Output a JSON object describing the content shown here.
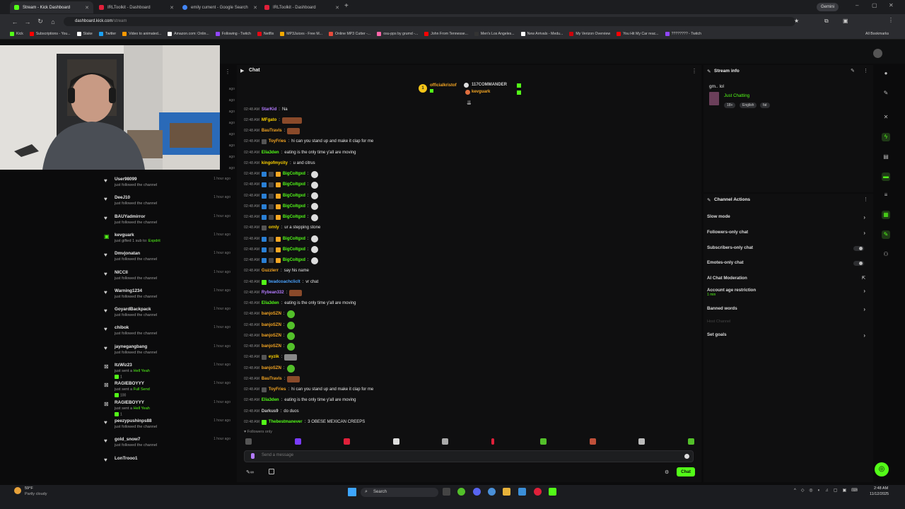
{
  "browser": {
    "tabs": [
      {
        "label": "Stream - Kick Dashboard",
        "color": "#53fc18",
        "active": true
      },
      {
        "label": "IRLToolkit - Dashboard",
        "color": "#e0203a",
        "active": false
      },
      {
        "label": "emily cument - Google Search",
        "color": "#4285f4",
        "active": false
      },
      {
        "label": "IRLToolkit - Dashboard",
        "color": "#e0203a",
        "active": false
      }
    ],
    "gemini_label": "Gemini",
    "url_host": "dashboard.kick.com",
    "url_path": "/stream",
    "bookmarks": [
      {
        "label": "Kick",
        "color": "#53fc18"
      },
      {
        "label": "Subscriptions - You...",
        "color": "#ff0000"
      },
      {
        "label": "Stake",
        "color": "#ffffff"
      },
      {
        "label": "Twitter",
        "color": "#1da1f2"
      },
      {
        "label": "Video to animated...",
        "color": "#ff9900"
      },
      {
        "label": "Amazon.com: Onlin...",
        "color": "#ffffff"
      },
      {
        "label": "Following - Twitch",
        "color": "#9146ff"
      },
      {
        "label": "Netflix",
        "color": "#e50914"
      },
      {
        "label": "MP3Juices - Free M...",
        "color": "#f2a900"
      },
      {
        "label": "Online MP3 Cutter -...",
        "color": "#e74c3c"
      },
      {
        "label": "osu-pps by grumd -...",
        "color": "#ff66aa"
      },
      {
        "label": "John From Tennesse...",
        "color": "#ff0000"
      },
      {
        "label": "Men's Los Angeles...",
        "color": "#333333"
      },
      {
        "label": "New Arrivals - Medu...",
        "color": "#ffffff"
      },
      {
        "label": "My Verizon Overview",
        "color": "#cd040b"
      },
      {
        "label": "You Hit My Car reac...",
        "color": "#ff0000"
      },
      {
        "label": "???????? - Twitch",
        "color": "#9146ff"
      }
    ],
    "all_bookmarks": "All Bookmarks"
  },
  "feed": [
    {
      "name": "User98099",
      "desc": "just followed the channel",
      "time": "1 hour ago",
      "icon": "heart-icon"
    },
    {
      "name": "DeeJ10",
      "desc": "just followed the channel",
      "time": "1 hour ago",
      "icon": "heart-icon"
    },
    {
      "name": "BAUYadmirror",
      "desc": "just followed the channel",
      "time": "1 hour ago",
      "icon": "heart-icon"
    },
    {
      "name": "kevguark",
      "desc": "just gifted 1 sub to: ",
      "highlight": "Expdrit",
      "time": "1 hour ago",
      "icon": "gift-icon"
    },
    {
      "name": "Dmvjonatan",
      "desc": "just followed the channel",
      "time": "1 hour ago",
      "icon": "heart-icon"
    },
    {
      "name": "NICCII",
      "desc": "just followed the channel",
      "time": "1 hour ago",
      "icon": "heart-icon"
    },
    {
      "name": "Warning1234",
      "desc": "just followed the channel",
      "time": "1 hour ago",
      "icon": "heart-icon"
    },
    {
      "name": "GoyardBackpack",
      "desc": "just followed the channel",
      "time": "1 hour ago",
      "icon": "heart-icon"
    },
    {
      "name": "chibok",
      "desc": "just followed the channel",
      "time": "1 hour ago",
      "icon": "heart-icon"
    },
    {
      "name": "jaynegangbang",
      "desc": "just followed the channel",
      "time": "1 hour ago",
      "icon": "heart-icon"
    },
    {
      "name": "ItzWiz23",
      "desc": "just sent a ",
      "highlight": "Hell Yeah",
      "sub": "1",
      "time": "1 hour ago",
      "icon": "kick-icon"
    },
    {
      "name": "RAGIEBOYYY",
      "desc": "just sent a ",
      "highlight": "Full Send",
      "sub": "100",
      "time": "1 hour ago",
      "icon": "kick-icon"
    },
    {
      "name": "RAGIEBOYYY",
      "desc": "just sent a ",
      "highlight": "Hell Yeah",
      "sub": "1",
      "time": "1 hour ago",
      "icon": "kick-icon"
    },
    {
      "name": "peezypushinps88",
      "desc": "just followed the channel",
      "time": "1 hour ago",
      "icon": "heart-icon"
    },
    {
      "name": "gold_snow7",
      "desc": "just followed the channel",
      "time": "1 hour ago",
      "icon": "heart-icon"
    },
    {
      "name": "LonTrooo1",
      "desc": "",
      "time": "",
      "icon": "heart-icon"
    }
  ],
  "chat": {
    "title": "Chat",
    "pinned": [
      {
        "name": "officialkristof",
        "color": "#f5a623"
      },
      {
        "name": "117COMMANDER",
        "color": "#cfcfcf"
      },
      {
        "name": "kevguark",
        "color": "#f5a623"
      }
    ],
    "messages": [
      {
        "time": "02:48 AM",
        "user": "StarKid",
        "color": "#b47bff",
        "text": "Na",
        "emote": ""
      },
      {
        "time": "02:48 AM",
        "user": "MFgato",
        "color": "#ffd400",
        "text": "",
        "emote": "#8a4a2a"
      },
      {
        "time": "02:48 AM",
        "user": "BauTravis",
        "color": "#f5a623",
        "text": "",
        "emote": "#8a4a2a"
      },
      {
        "time": "02:48 AM",
        "user": "ToyFries",
        "color": "#f5a623",
        "text": "hi can you stand up and make it clap for me",
        "emote": ""
      },
      {
        "time": "02:48 AM",
        "user": "Elia3den",
        "color": "#53fc18",
        "text": "eating is the only time y'all are moving",
        "emote": ""
      },
      {
        "time": "02:48 AM",
        "user": "kingofmycity",
        "color": "#ffd400",
        "text": "u and citrus",
        "emote": ""
      },
      {
        "time": "02:48 AM",
        "user": "BigColtgxd",
        "color": "#53fc18",
        "text": "",
        "emote": "#dddddd"
      },
      {
        "time": "02:48 AM",
        "user": "BigColtgxd",
        "color": "#53fc18",
        "text": "",
        "emote": "#dddddd"
      },
      {
        "time": "02:48 AM",
        "user": "BigColtgxd",
        "color": "#53fc18",
        "text": "",
        "emote": "#dddddd"
      },
      {
        "time": "02:48 AM",
        "user": "BigColtgxd",
        "color": "#53fc18",
        "text": "",
        "emote": "#dddddd"
      },
      {
        "time": "02:48 AM",
        "user": "BigColtgxd",
        "color": "#53fc18",
        "text": "",
        "emote": "#dddddd"
      },
      {
        "time": "02:48 AM",
        "user": "ornly",
        "color": "#ffd400",
        "text": "ur a stepping stone",
        "emote": ""
      },
      {
        "time": "02:48 AM",
        "user": "BigColtgxd",
        "color": "#53fc18",
        "text": "",
        "emote": "#dddddd"
      },
      {
        "time": "02:48 AM",
        "user": "BigColtgxd",
        "color": "#53fc18",
        "text": "",
        "emote": "#dddddd"
      },
      {
        "time": "02:48 AM",
        "user": "BigColtgxd",
        "color": "#53fc18",
        "text": "",
        "emote": "#dddddd"
      },
      {
        "time": "02:48 AM",
        "user": "Guzzlerr",
        "color": "#f5a623",
        "text": "say his name",
        "emote": ""
      },
      {
        "time": "02:48 AM",
        "user": "twadcoachcliclt",
        "color": "#4aa3ff",
        "text": "vr chat",
        "emote": ""
      },
      {
        "time": "02:48 AM",
        "user": "Rybean332",
        "color": "#b47bff",
        "text": "",
        "emote": "#8a4a2a"
      },
      {
        "time": "02:48 AM",
        "user": "Elia3den",
        "color": "#53fc18",
        "text": "eating is the only time y'all are moving",
        "emote": ""
      },
      {
        "time": "02:48 AM",
        "user": "banjoSZN",
        "color": "#f5a623",
        "text": "",
        "emote": "#53c02a"
      },
      {
        "time": "02:48 AM",
        "user": "banjoSZN",
        "color": "#f5a623",
        "text": "",
        "emote": "#53c02a"
      },
      {
        "time": "02:48 AM",
        "user": "banjoSZN",
        "color": "#f5a623",
        "text": "",
        "emote": "#53c02a"
      },
      {
        "time": "02:48 AM",
        "user": "banjoSZN",
        "color": "#f5a623",
        "text": "",
        "emote": "#53c02a"
      },
      {
        "time": "02:48 AM",
        "user": "eyzik",
        "color": "#ffd400",
        "text": "",
        "emote": "#888888"
      },
      {
        "time": "02:48 AM",
        "user": "banjoSZN",
        "color": "#f5a623",
        "text": "",
        "emote": "#53c02a"
      },
      {
        "time": "02:48 AM",
        "user": "BauTravis",
        "color": "#f5a623",
        "text": "",
        "emote": "#8a4a2a"
      },
      {
        "time": "02:48 AM",
        "user": "ToyFries",
        "color": "#f5a623",
        "text": "hi can you stand up and make it clap for me",
        "emote": ""
      },
      {
        "time": "02:48 AM",
        "user": "Elia3den",
        "color": "#53fc18",
        "text": "eating is the only time y'all are moving",
        "emote": ""
      },
      {
        "time": "02:48 AM",
        "user": "Darkus9",
        "color": "#cfcfcf",
        "text": "do duos",
        "emote": ""
      },
      {
        "time": "02:48 AM",
        "user": "Thebestmanever",
        "color": "#53fc18",
        "text": "3 OBESE MEXICAN CREEPS",
        "emote": ""
      }
    ],
    "followers_only": "Followers only",
    "input_placeholder": "Send a message",
    "send_label": "Chat"
  },
  "stream_info": {
    "title": "Stream info",
    "stream_title": "gm.. lol",
    "category": "Just Chatting",
    "tags": [
      "18+",
      "English",
      "fat"
    ]
  },
  "channel_actions": {
    "title": "Channel Actions",
    "items": [
      {
        "label": "Slow mode",
        "type": "chevron",
        "note": ""
      },
      {
        "label": "Followers-only chat",
        "type": "chevron",
        "note": ""
      },
      {
        "label": "Subscribers-only chat",
        "type": "toggle",
        "note": ""
      },
      {
        "label": "Emotes-only chat",
        "type": "toggle",
        "note": ""
      },
      {
        "label": "AI Chat Moderation",
        "type": "external",
        "note": ""
      },
      {
        "label": "Account age restriction",
        "type": "chevron",
        "note": "1 min"
      },
      {
        "label": "Banned words",
        "type": "chevron",
        "note": ""
      },
      {
        "label": "Host Channel",
        "type": "disabled",
        "note": ""
      },
      {
        "label": "Set goals",
        "type": "chevron",
        "note": ""
      }
    ]
  },
  "taskbar": {
    "search": "Search",
    "weather_temp": "59°F",
    "weather_desc": "Partly cloudy",
    "time": "2:48 AM",
    "date": "11/12/2025"
  }
}
